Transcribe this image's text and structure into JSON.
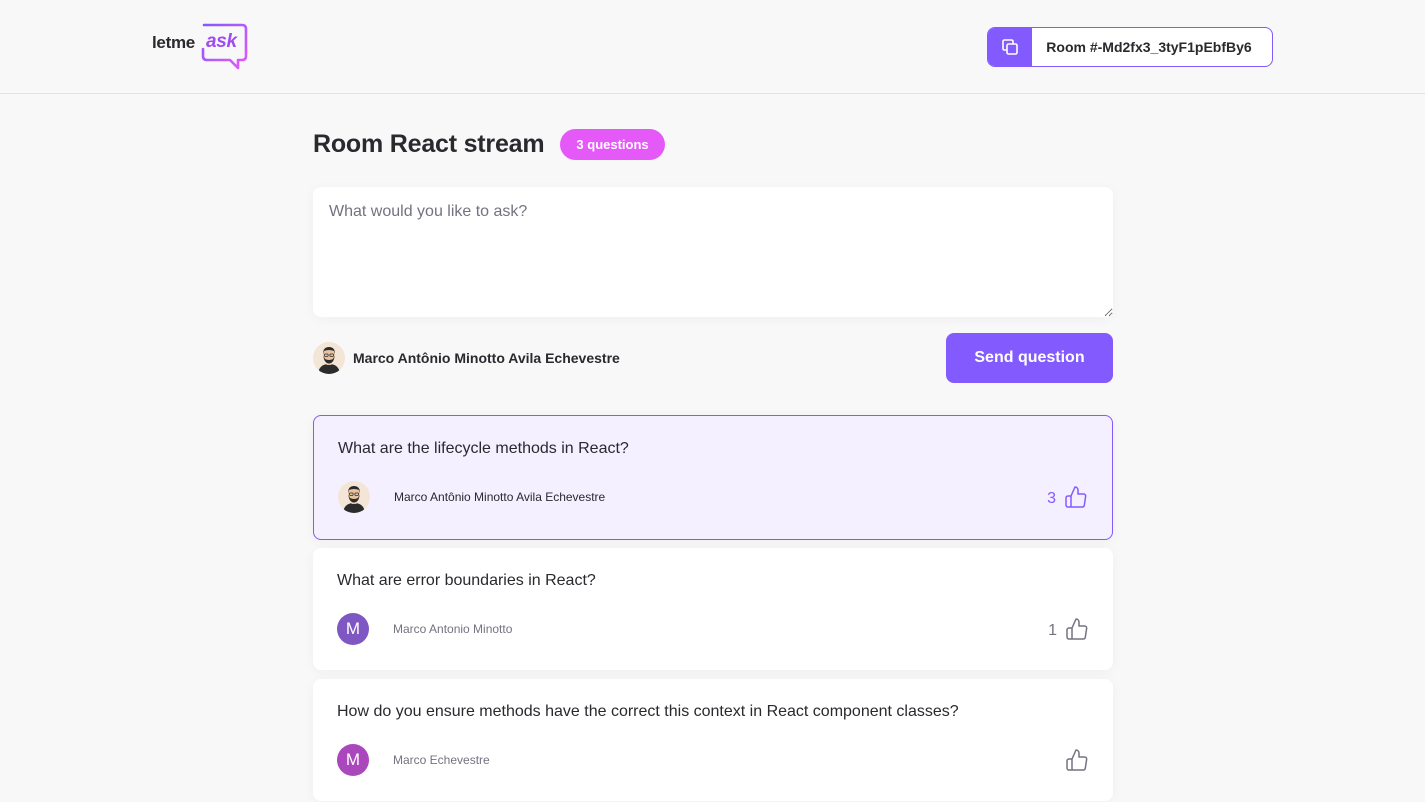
{
  "header": {
    "logo_text_dark": "letme",
    "logo_text_accent": "ask",
    "room_code_label": "Room #-Md2fx3_3tyF1pEbfBy6"
  },
  "room": {
    "title": "Room React stream",
    "question_count_badge": "3 questions"
  },
  "form": {
    "placeholder": "What would you like to ask?",
    "value": "",
    "user_name": "Marco Antônio Minotto Avila Echevestre",
    "send_label": "Send question"
  },
  "questions": [
    {
      "content": "What are the lifecycle methods in React?",
      "author": "Marco Antônio Minotto Avila Echevestre",
      "avatar_letter": "",
      "likes": "3",
      "highlighted": true,
      "liked": true
    },
    {
      "content": "What are error boundaries in React?",
      "author": "Marco Antonio Minotto",
      "avatar_letter": "M",
      "avatar_color": "#7e57c2",
      "likes": "1",
      "highlighted": false,
      "liked": false
    },
    {
      "content": "How do you ensure methods have the correct this context in React component classes?",
      "author": "Marco Echevestre",
      "avatar_letter": "M",
      "avatar_color": "#ab47bc",
      "likes": "",
      "highlighted": false,
      "liked": false
    }
  ],
  "colors": {
    "primary": "#835afd",
    "badge": "#e559f9",
    "highlight_bg": "#f4f0ff"
  },
  "icons": {
    "copy": "copy-icon",
    "like": "thumbs-up-icon",
    "logo": "speech-bubble-logo"
  }
}
